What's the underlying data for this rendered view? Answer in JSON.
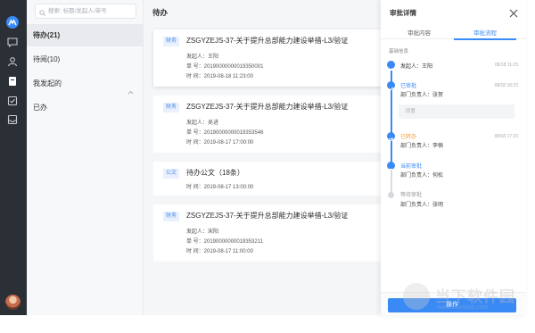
{
  "search": {
    "placeholder": "搜索: 标题/发起人/单号"
  },
  "nav": {
    "items": [
      {
        "label": "待办(21)"
      },
      {
        "label": "待阅(10)"
      },
      {
        "label": "我发起的"
      },
      {
        "label": "已办"
      }
    ]
  },
  "main": {
    "title": "待办",
    "cards": [
      {
        "tag": "财务",
        "title": "ZSGYZEJS-37-关于提升总部能力建设举措-L3/验证",
        "initiator": "发起人：王阳",
        "number": "单    号：20190000000019350001",
        "time": "时    间：2019-08-18  11:23:00"
      },
      {
        "tag": "财务",
        "title": "ZSGYZEJS-37-关于提升总部能力建设举措-L3/验证",
        "initiator": "发起人：吴进",
        "number": "单    号：20190000000019353546",
        "time": "时    间：2019-08-17  17:00:00"
      },
      {
        "tag": "公文",
        "title": "待办公文（18条）",
        "time": "时    间：2019-08-17  13:00:00"
      },
      {
        "tag": "财务",
        "title": "ZSGYZEJS-37-关于提升总部能力建设举措-L3/验证",
        "initiator": "发起人：宋阳",
        "number": "单    号：20190000000019353211",
        "time": "时    间：2019-08-17  11:00:00"
      }
    ]
  },
  "drawer": {
    "title": "审批详情",
    "tabs": [
      {
        "label": "审批内容"
      },
      {
        "label": "审批流程"
      }
    ],
    "section_label": "基础信息",
    "timeline": [
      {
        "status": "发起人：王阳",
        "time": "08/18 11:23"
      },
      {
        "status": "已审批",
        "person": "部门负责人：张贺",
        "time": "08/18 16:23"
      },
      {
        "status": "已转办",
        "person": "部门负责人：李楠",
        "time": "08/18 17:23"
      },
      {
        "status": "当前审批",
        "person": "部门负责人：何松"
      },
      {
        "status": "等待审批",
        "person": "部门负责人：张明"
      }
    ],
    "comment_placeholder": "同意",
    "action_label": "操作"
  },
  "watermark": {
    "text": "当下软件园",
    "url": "www.downxia.com"
  },
  "colors": {
    "accent": "#3a8af5",
    "rail": "#2b2f36",
    "transfer": "#f39a2e"
  }
}
